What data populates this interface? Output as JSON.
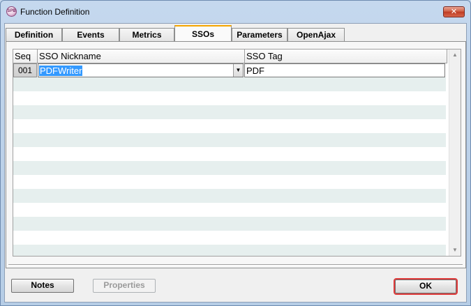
{
  "window": {
    "title": "Function Definition",
    "close_label": "✕",
    "app_icon_label": "SPB"
  },
  "tabs": [
    {
      "label": "Definition",
      "active": false
    },
    {
      "label": "Events",
      "active": false
    },
    {
      "label": "Metrics",
      "active": false
    },
    {
      "label": "SSOs",
      "active": true
    },
    {
      "label": "Parameters",
      "active": false
    },
    {
      "label": "OpenAjax",
      "active": false
    }
  ],
  "grid": {
    "columns": [
      "Seq",
      "SSO Nickname",
      "SSO Tag"
    ],
    "rows": [
      {
        "seq": "001",
        "nickname": "PDFWriter",
        "tag": "PDF"
      }
    ],
    "dropdown_arrow": "▼",
    "scroll_up": "▲",
    "scroll_down": "▼"
  },
  "buttons": {
    "notes": "Notes",
    "properties": "Properties",
    "ok": "OK"
  },
  "colors": {
    "selection": "#3399ff",
    "active_tab_accent": "#f5a500",
    "default_button_outline": "#e03b3b",
    "alt_row": "#e6efee"
  }
}
